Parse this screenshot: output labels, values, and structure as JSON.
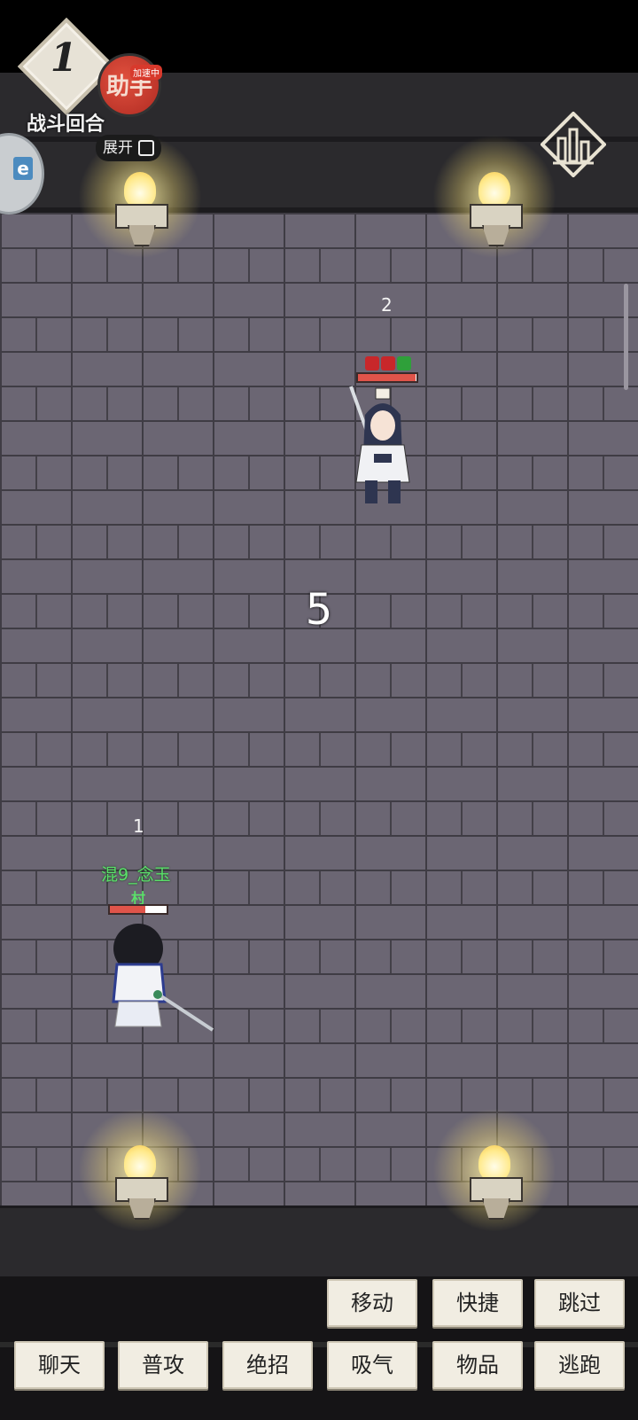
{
  "hud": {
    "round_number": "1",
    "round_label": "战斗回合",
    "helper_label": "助手",
    "helper_badge": "加速中",
    "expand_label": "展开",
    "side_avatar_letter": "e"
  },
  "battle": {
    "countdown": "5",
    "enemy": {
      "slot": "2",
      "hp_fraction": 0.98,
      "buffs": [
        "red-swirl",
        "red-swirl",
        "green-shield"
      ]
    },
    "player": {
      "slot": "1",
      "name": "混9_念玉",
      "tag": "村",
      "hp_fraction": 0.62
    }
  },
  "actions": {
    "row1": [
      "移动",
      "快捷",
      "跳过"
    ],
    "row2": [
      "聊天",
      "普攻",
      "绝招",
      "吸气",
      "物品",
      "逃跑"
    ]
  },
  "colors": {
    "floor": "#6b6673",
    "player_name": "#5be06a",
    "hp": "#e0544a"
  }
}
